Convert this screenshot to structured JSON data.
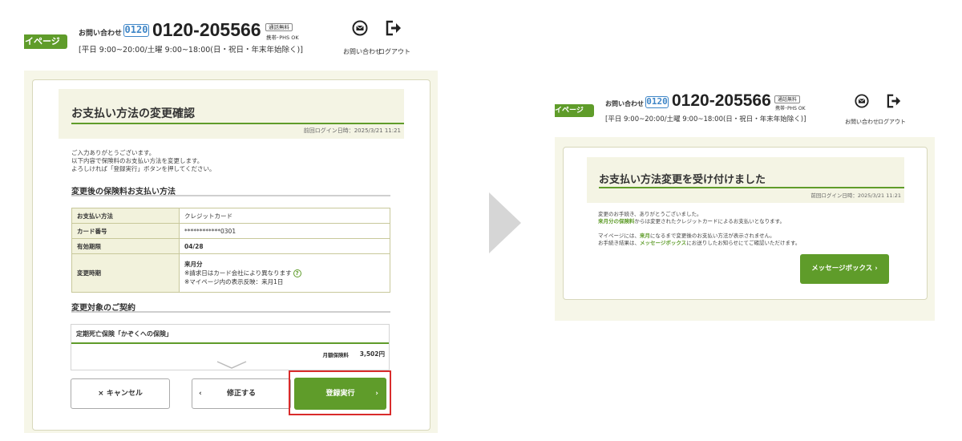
{
  "colors": {
    "accent": "#5f9c2a",
    "highlight": "#d92b2b",
    "badge_blue": "#3f86c7"
  },
  "header": {
    "mypage_tab": "イページ",
    "contact_label": "お問い合わせ",
    "freedial_badge": "0120",
    "phone": "0120-205566",
    "call_free_badge": "通話無料",
    "mobile_ok": "携帯･PHS OK",
    "hours": "[平日 9:00~20:00/土曜 9:00~18:00(日・祝日・年末年始除く)]",
    "mail_icon": "mail-icon",
    "logout_icon": "logout-icon",
    "contact_icon_label": "お問い合わせ",
    "logout_label": "ログアウト"
  },
  "confirm": {
    "title": "お支払い方法の変更確認",
    "last_login": "前回ログイン日時：2025/3/21 11:21",
    "intro": [
      "ご入力ありがとうございます。",
      "以下内容で保険料のお支払い方法を変更します。",
      "よろしければ「登録実行」ボタンを押してください。"
    ],
    "payment_section": "変更後の保険料お支払い方法",
    "rows": [
      {
        "label": "お支払い方法",
        "value": "クレジットカード"
      },
      {
        "label": "カード番号",
        "value": "************0301"
      },
      {
        "label": "有効期限",
        "value": "04/28"
      },
      {
        "label": "変更時期",
        "lines": [
          "来月分",
          "※請求日はカード会社により異なります",
          "※マイページ内の表示反映：来月1日"
        ]
      }
    ],
    "contract_section": "変更対象のご契約",
    "contract": {
      "name": "定期死亡保険「かぞくへの保険」",
      "premium_label": "月額保険料",
      "premium_value": "3,502円"
    },
    "cancel_button": "× キャンセル",
    "fix_button": "修正する",
    "submit_button": "登録実行"
  },
  "complete": {
    "title": "お支払い方法変更を受け付けました",
    "last_login": "前回ログイン日時：2025/3/21 11:21",
    "line1": "変更のお手続き、ありがとうございました。",
    "line2_bold": "来月分の保険料",
    "line2_rest": "からは変更されたクレジットカードによるお支払いとなります。",
    "line3_a": "マイページには、",
    "line3_bold": "来月",
    "line3_b": "になるまで変更後のお支払い方法が表示されません。",
    "line4_a": "お手続き結果は、",
    "line4_bold": "メッセージボックス",
    "line4_b": "にお送りしたお知らせにてご確認いただけます。",
    "message_box_button": "メッセージボックス ›"
  }
}
